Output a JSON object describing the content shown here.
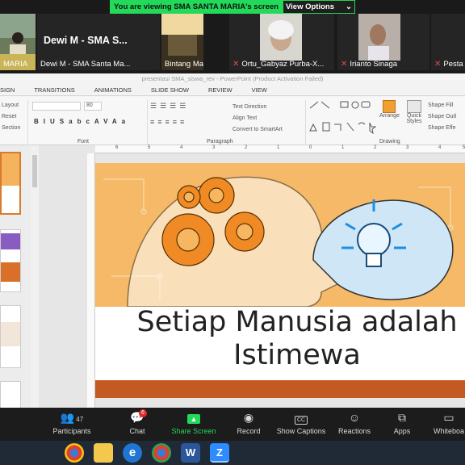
{
  "banner": {
    "message": "You are viewing SMA SANTA MARIA's screen",
    "view_options": "View Options",
    "view_options_chevron": "⌄"
  },
  "participants": [
    {
      "name": "MARIA",
      "muted": false
    },
    {
      "name": "Dewi M - SMA Santa Ma...",
      "display": "Dewi M - SMA S...",
      "muted": false
    },
    {
      "name": "Bintang Manullang",
      "muted": false
    },
    {
      "name": "Ortu_Gabyaz Purba-X...",
      "muted": true
    },
    {
      "name": "Irianto Sinaga",
      "muted": true
    },
    {
      "name": "Pesta",
      "muted": true
    }
  ],
  "powerpoint": {
    "window_title": "presentasi SMA_siswa_rev - PowerPoint (Product Activation Failed)",
    "tabs": [
      "SIGN",
      "TRANSITIONS",
      "ANIMATIONS",
      "SLIDE SHOW",
      "REVIEW",
      "VIEW"
    ],
    "ribbon": {
      "slides_layout": "Layout",
      "slides_reset": "Reset",
      "slides_section": "Section",
      "font_size": "80",
      "font_group": "Font",
      "paragraph_group": "Paragraph",
      "drawing_group": "Drawing",
      "text_direction": "Text Direction",
      "align_text": "Align Text",
      "convert_smartart": "Convert to SmartArt",
      "arrange": "Arrange",
      "quick_styles": "Quick Styles",
      "shape_fill": "Shape Fill",
      "shape_outline": "Shape Outl",
      "shape_effects": "Shape Effe"
    },
    "ruler_numbers": [
      "6",
      "5",
      "4",
      "3",
      "2",
      "1",
      "0",
      "1",
      "2",
      "3",
      "4",
      "5"
    ],
    "slide_title_line1": "Setiap Manusia adalah",
    "slide_title_line2": "Istimewa"
  },
  "toolbar": {
    "participants_label": "Participants",
    "participants_count": "47",
    "chat_label": "Chat",
    "chat_badge": "6",
    "share_screen_label": "Share Screen",
    "record_label": "Record",
    "captions_label": "Show Captions",
    "reactions_label": "Reactions",
    "apps_label": "Apps",
    "whiteboard_label": "Whiteboa"
  },
  "colors": {
    "banner_green": "#23d959",
    "toolbar_bg": "#1c1c1c",
    "slide_accent": "#c25a22",
    "slide_banner": "#f4b35c"
  },
  "taskbar_apps": [
    "chrome-icon",
    "file-explorer-icon",
    "edge-icon",
    "chrome-icon",
    "word-icon",
    "zoom-icon"
  ]
}
